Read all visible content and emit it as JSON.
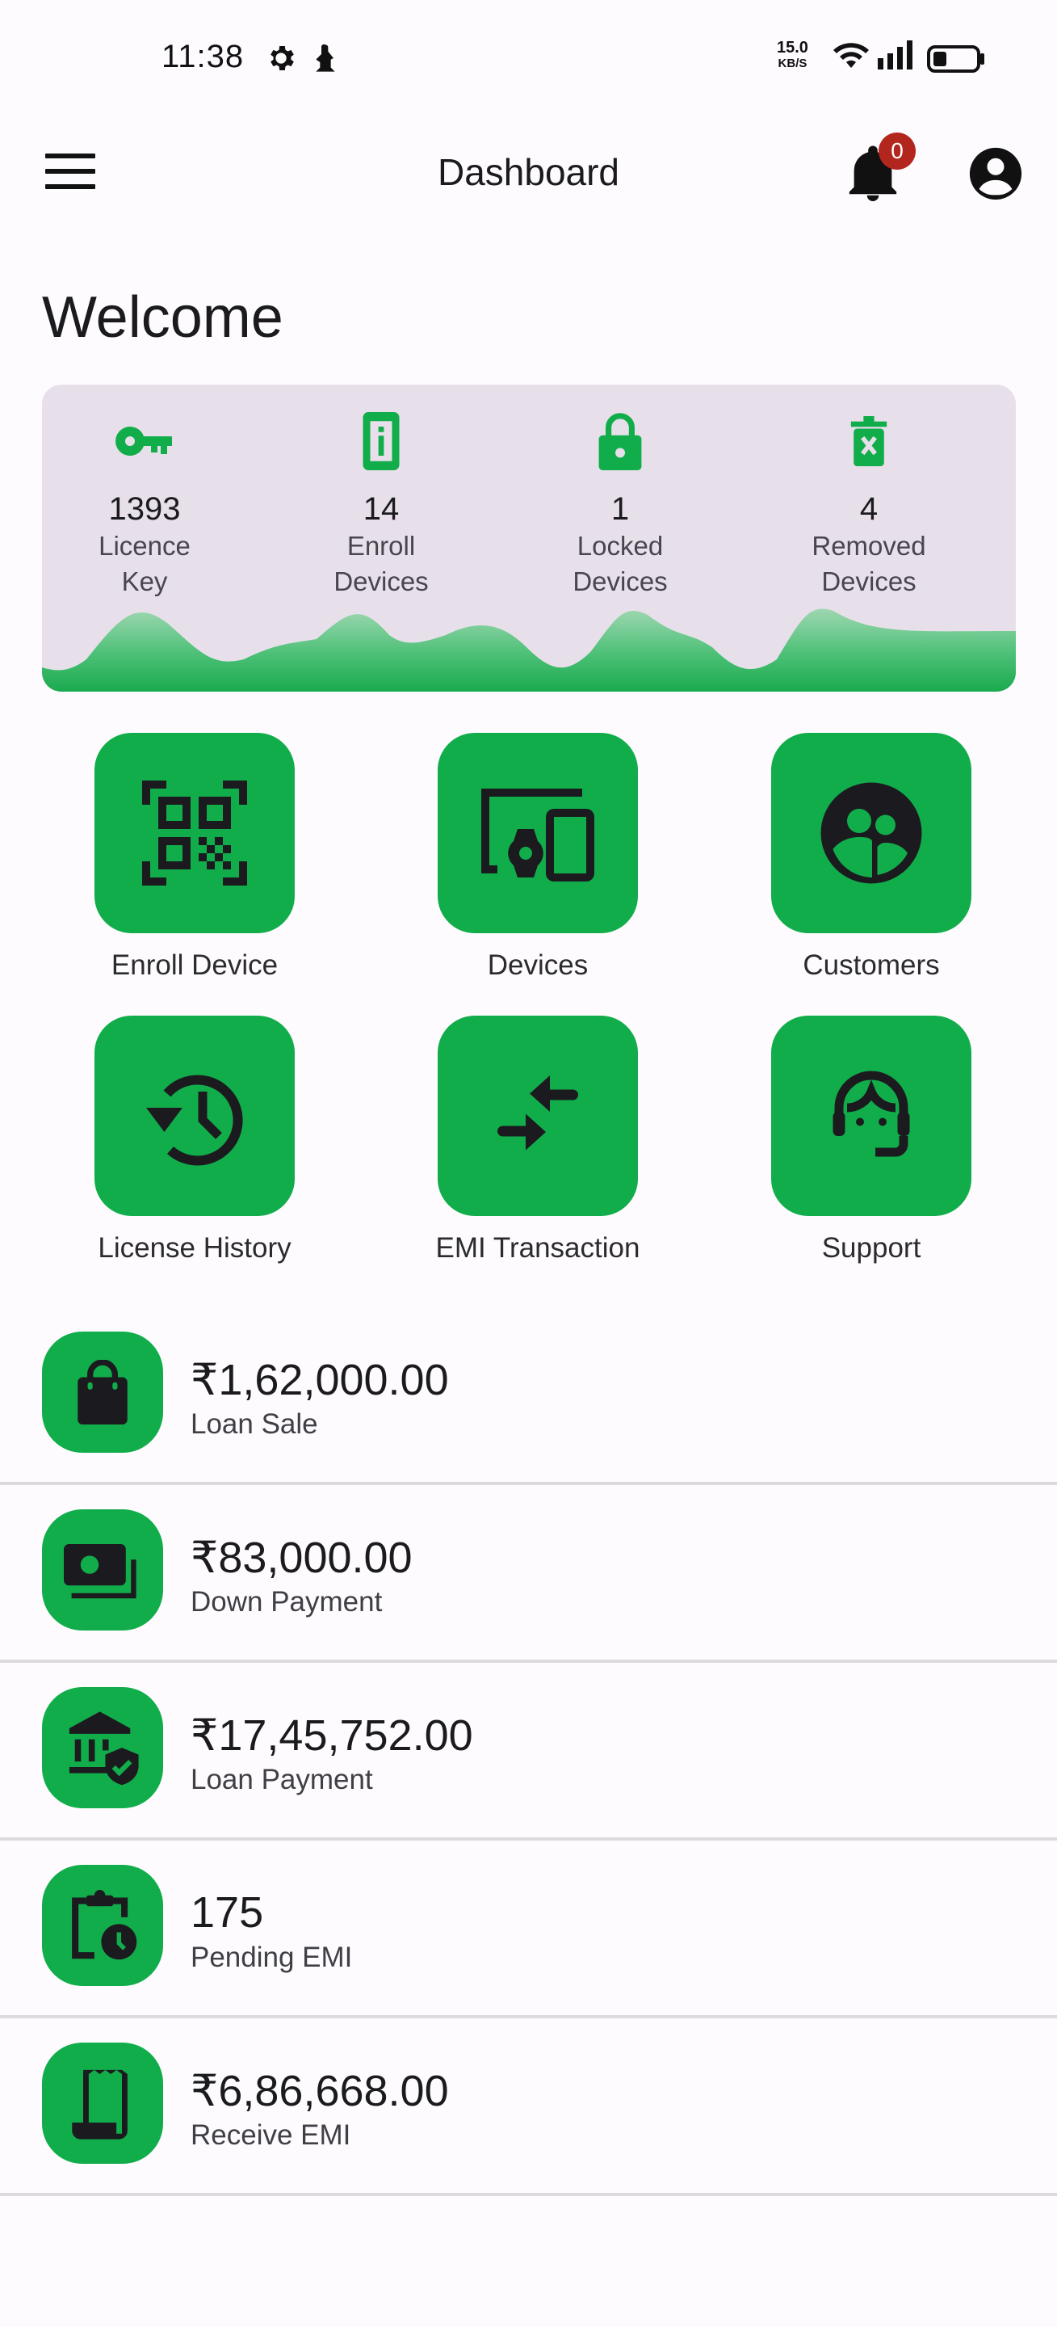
{
  "status_bar": {
    "time": "11:38",
    "net_speed_value": "15.0",
    "net_speed_unit": "KB/S",
    "icons": [
      "settings-gear-icon",
      "notification-app-icon",
      "wifi-icon",
      "signal-icon",
      "battery-icon"
    ]
  },
  "app_bar": {
    "title": "Dashboard",
    "notification_count": "0",
    "icons": [
      "menu-icon",
      "bell-icon",
      "account-circle-icon"
    ]
  },
  "welcome": "Welcome",
  "colors": {
    "accent": "#12ad4b",
    "stats_card_bg": "#e7e0ea",
    "badge": "#b3261e",
    "background": "#fdfbfe",
    "icon_dark": "#1b1b1f"
  },
  "stats": [
    {
      "value": "1393",
      "label": "Licence\nKey",
      "icon": "key-icon"
    },
    {
      "value": "14",
      "label": "Enroll\nDevices",
      "icon": "phone-info-icon"
    },
    {
      "value": "1",
      "label": "Locked\nDevices",
      "icon": "lock-icon"
    },
    {
      "value": "4",
      "label": "Removed\nDevices",
      "icon": "delete-icon"
    }
  ],
  "quick_actions": [
    {
      "label": "Enroll Device",
      "icon": "qr-scan-icon"
    },
    {
      "label": "Devices",
      "icon": "devices-icon"
    },
    {
      "label": "Customers",
      "icon": "group-circle-icon"
    },
    {
      "label": "License History",
      "icon": "history-icon"
    },
    {
      "label": "EMI Transaction",
      "icon": "compare-arrows-icon"
    },
    {
      "label": "Support",
      "icon": "support-agent-icon"
    }
  ],
  "summary": [
    {
      "value": "₹1,62,000.00",
      "label": "Loan Sale",
      "icon": "shopping-bag-icon"
    },
    {
      "value": "₹83,000.00",
      "label": "Down Payment",
      "icon": "payments-icon"
    },
    {
      "value": "₹17,45,752.00",
      "label": "Loan Payment",
      "icon": "bank-shield-icon"
    },
    {
      "value": "175",
      "label": "Pending EMI",
      "icon": "pending-clipboard-icon"
    },
    {
      "value": "₹6,86,668.00",
      "label": "Receive EMI",
      "icon": "receipt-icon"
    }
  ]
}
